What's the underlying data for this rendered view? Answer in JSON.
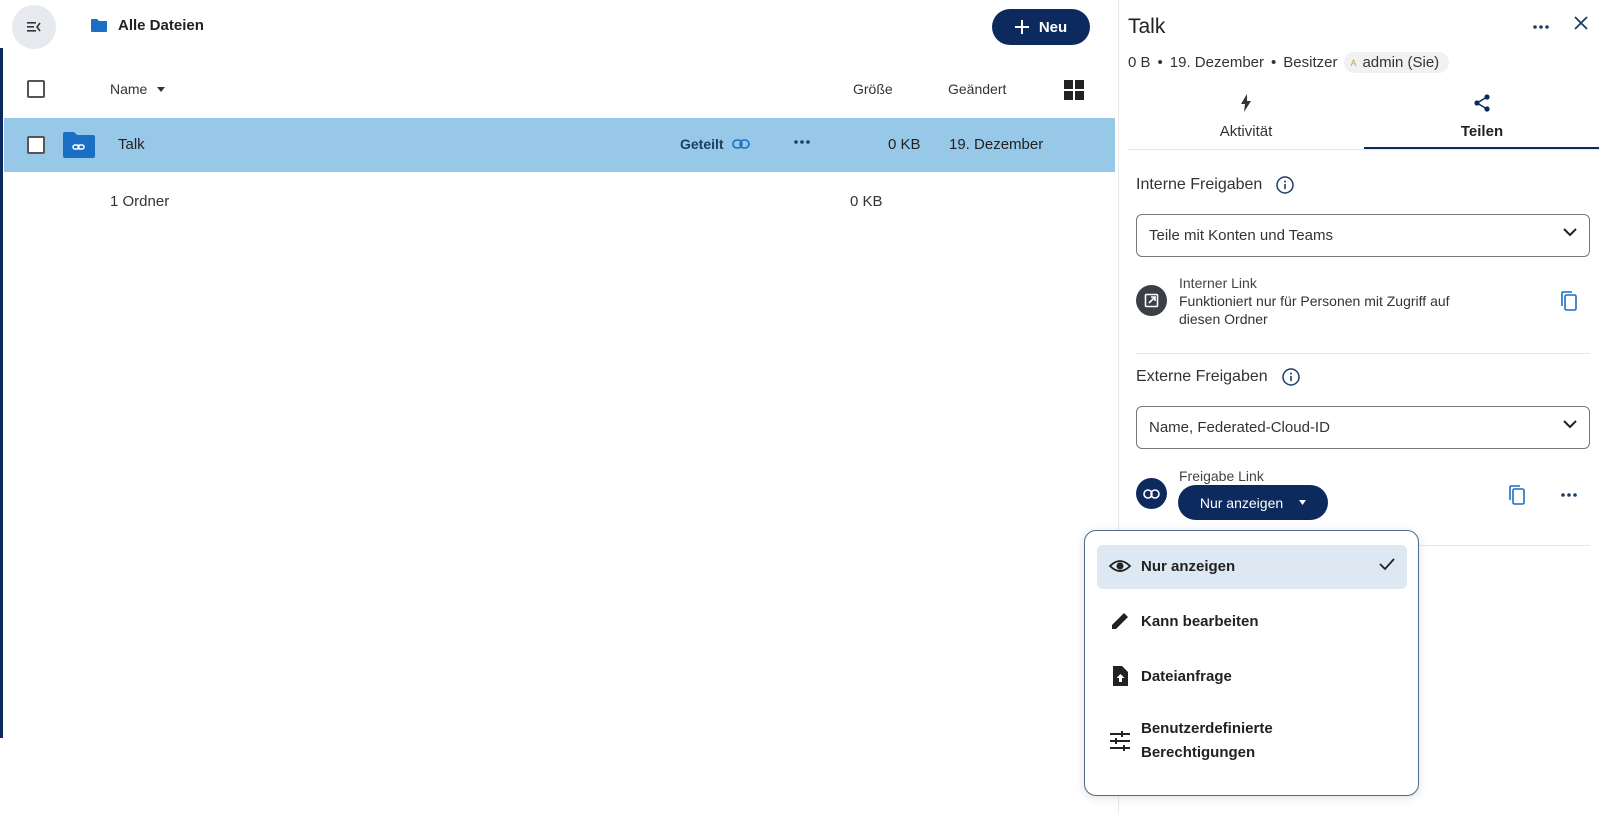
{
  "files": {
    "breadcrumb": "Alle Dateien",
    "new_button": "Neu",
    "columns": {
      "name": "Name",
      "size": "Größe",
      "changed": "Geändert"
    },
    "rows": [
      {
        "name": "Talk",
        "shared_label": "Geteilt",
        "size": "0 KB",
        "changed": "19. Dezember"
      }
    ],
    "summary": {
      "count": "1 Ordner",
      "size": "0 KB"
    }
  },
  "sidebar": {
    "title": "Talk",
    "meta": {
      "size": "0 B",
      "date": "19. Dezember",
      "owner_label": "Besitzer",
      "owner_initial": "A",
      "owner_name": "admin (Sie)"
    },
    "tabs": [
      {
        "label": "Aktivität",
        "icon": "activity-icon"
      },
      {
        "label": "Teilen",
        "icon": "share-icon",
        "active": true
      }
    ],
    "internal": {
      "heading": "Interne Freigaben",
      "select_placeholder": "Teile mit Konten und Teams",
      "link_title": "Interner Link",
      "link_desc_1": "Funktioniert nur für Personen mit Zugriff auf",
      "link_desc_2": "diesen Ordner"
    },
    "external": {
      "heading": "Externe Freigaben",
      "select_placeholder": "Name, Federated-Cloud-ID",
      "link_title": "Freigabe Link",
      "permission_button": "Nur anzeigen"
    }
  },
  "menu": {
    "items": [
      {
        "label": "Nur anzeigen",
        "icon": "eye-icon",
        "selected": true
      },
      {
        "label": "Kann bearbeiten",
        "icon": "pencil-icon"
      },
      {
        "label": "Dateianfrage",
        "icon": "file-upload-icon"
      },
      {
        "label_1": "Benutzerdefinierte",
        "label_2": "Berechtigungen",
        "icon": "tune-icon"
      }
    ]
  },
  "colors": {
    "primary": "#0d2a5e",
    "selected_row": "#98c8e8",
    "menu_selected": "#dde8f3",
    "link_blue": "#1a6fc4"
  }
}
